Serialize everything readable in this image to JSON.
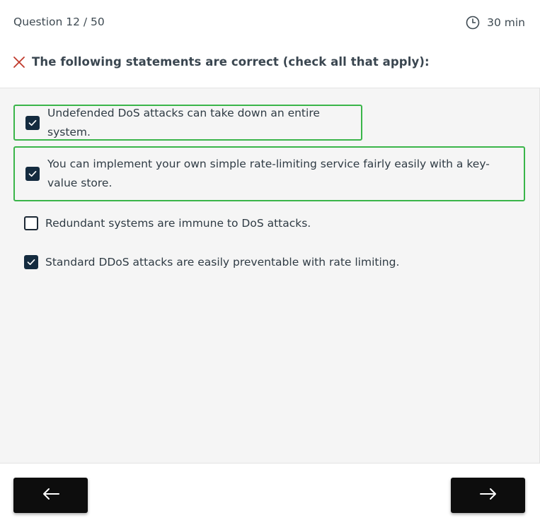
{
  "header": {
    "question_counter": "Question 12 / 50",
    "timer_label": "30 min",
    "question_title": "The following statements are correct (check all that apply):",
    "result_icon": "x-icon",
    "result_color": "#c0392b"
  },
  "options": [
    {
      "label": "Undefended DoS attacks can take down an entire system.",
      "checked": true,
      "correct": true
    },
    {
      "label": "You can implement your own simple rate-limiting service fairly easily with a key-value store.",
      "checked": true,
      "correct": true
    },
    {
      "label": "Redundant systems are immune to DoS attacks.",
      "checked": false,
      "correct": false
    },
    {
      "label": "Standard DDoS attacks are easily preventable with rate limiting.",
      "checked": true,
      "correct": false
    }
  ],
  "footer": {
    "prev_icon": "arrow-left-icon",
    "next_icon": "arrow-right-icon"
  },
  "colors": {
    "correct_border": "#3ab54a",
    "checkbox_fill": "#142b3f",
    "button_bg": "#0d0d0d"
  }
}
